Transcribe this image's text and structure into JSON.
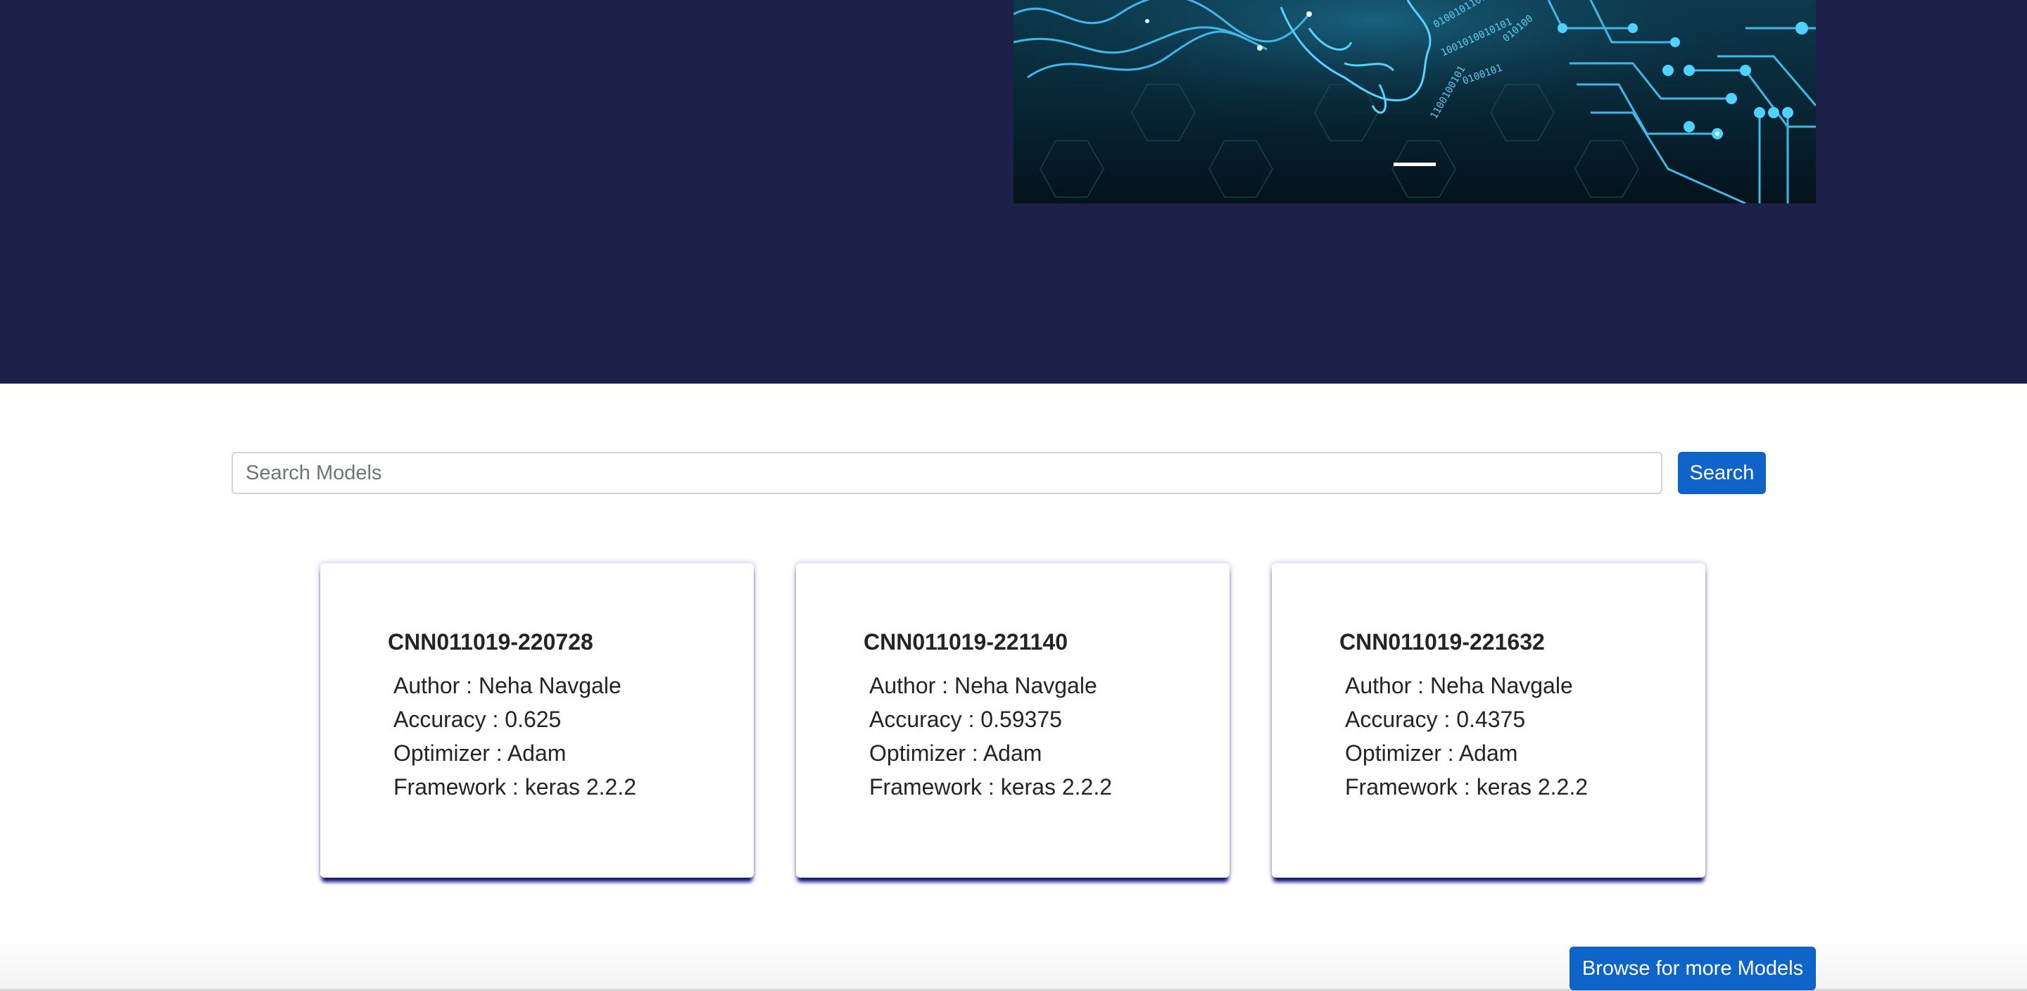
{
  "search": {
    "placeholder": "Search Models",
    "button_label": "Search"
  },
  "models": [
    {
      "name": "CNN011019-220728",
      "author": "Author : Neha Navgale",
      "accuracy": "Accuracy : 0.625",
      "optimizer": "Optimizer : Adam",
      "framework": "Framework : keras 2.2.2"
    },
    {
      "name": "CNN011019-221140",
      "author": "Author : Neha Navgale",
      "accuracy": "Accuracy : 0.59375",
      "optimizer": "Optimizer : Adam",
      "framework": "Framework : keras 2.2.2"
    },
    {
      "name": "CNN011019-221632",
      "author": "Author : Neha Navgale",
      "accuracy": "Accuracy : 0.4375",
      "optimizer": "Optimizer : Adam",
      "framework": "Framework : keras 2.2.2"
    }
  ],
  "browse": {
    "label": "Browse for more Models"
  },
  "colors": {
    "hero_background": "#1d2149",
    "primary_button": "#0e64c8",
    "card_shadow": "#0f0f7e"
  }
}
